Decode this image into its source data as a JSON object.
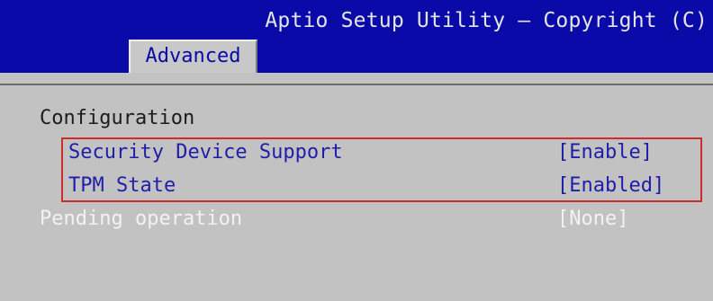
{
  "header": {
    "title": "Aptio Setup Utility – Copyright (C)",
    "active_tab": "Advanced"
  },
  "colors": {
    "header_bg": "#0a0aa8",
    "panel_bg": "#c2c2c2",
    "setting_text": "#1e1ea8",
    "highlight_border": "#cf2b2b"
  },
  "content": {
    "section_title": "Configuration",
    "items": [
      {
        "label": "Security Device Support",
        "value": "[Enable]"
      },
      {
        "label": "TPM State",
        "value": "[Enabled]"
      },
      {
        "label": "Pending operation",
        "value": "[None]"
      }
    ]
  }
}
